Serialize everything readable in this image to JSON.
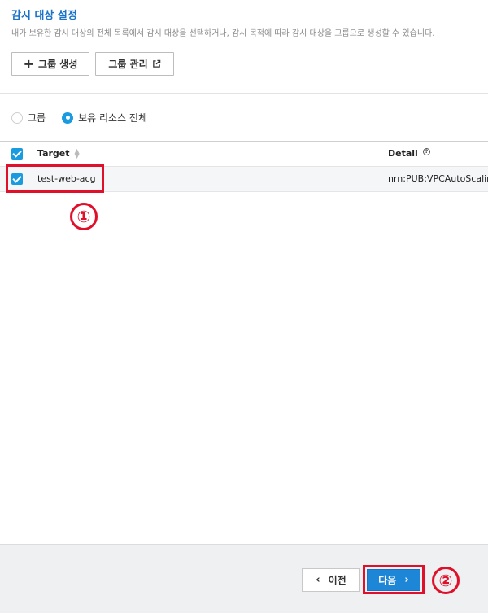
{
  "header": {
    "title": "감시 대상 설정",
    "description": "내가 보유한 감시 대상의 전체 목록에서 감시 대상을 선택하거나, 감시 목적에 따라 감시 대상을 그룹으로 생성할 수 있습니다."
  },
  "toolbar": {
    "create_group_label": "그룹 생성",
    "manage_group_label": "그룹 관리"
  },
  "view_mode": {
    "options": [
      {
        "label": "그룹",
        "selected": false
      },
      {
        "label": "보유 리소스 전체",
        "selected": true
      }
    ]
  },
  "table": {
    "columns": [
      "Target",
      "Detail"
    ],
    "rows": [
      {
        "target": "test-web-acg",
        "detail": "nrn:PUB:VPCAutoScaling",
        "checked": true
      }
    ]
  },
  "annotations": [
    "①",
    "②"
  ],
  "footer": {
    "prev_label": "이전",
    "next_label": "다음"
  },
  "colors": {
    "accent": "#1a73c9",
    "checkbox": "#1a9be0",
    "highlight": "#e0102a",
    "next_button": "#1e86d6"
  }
}
